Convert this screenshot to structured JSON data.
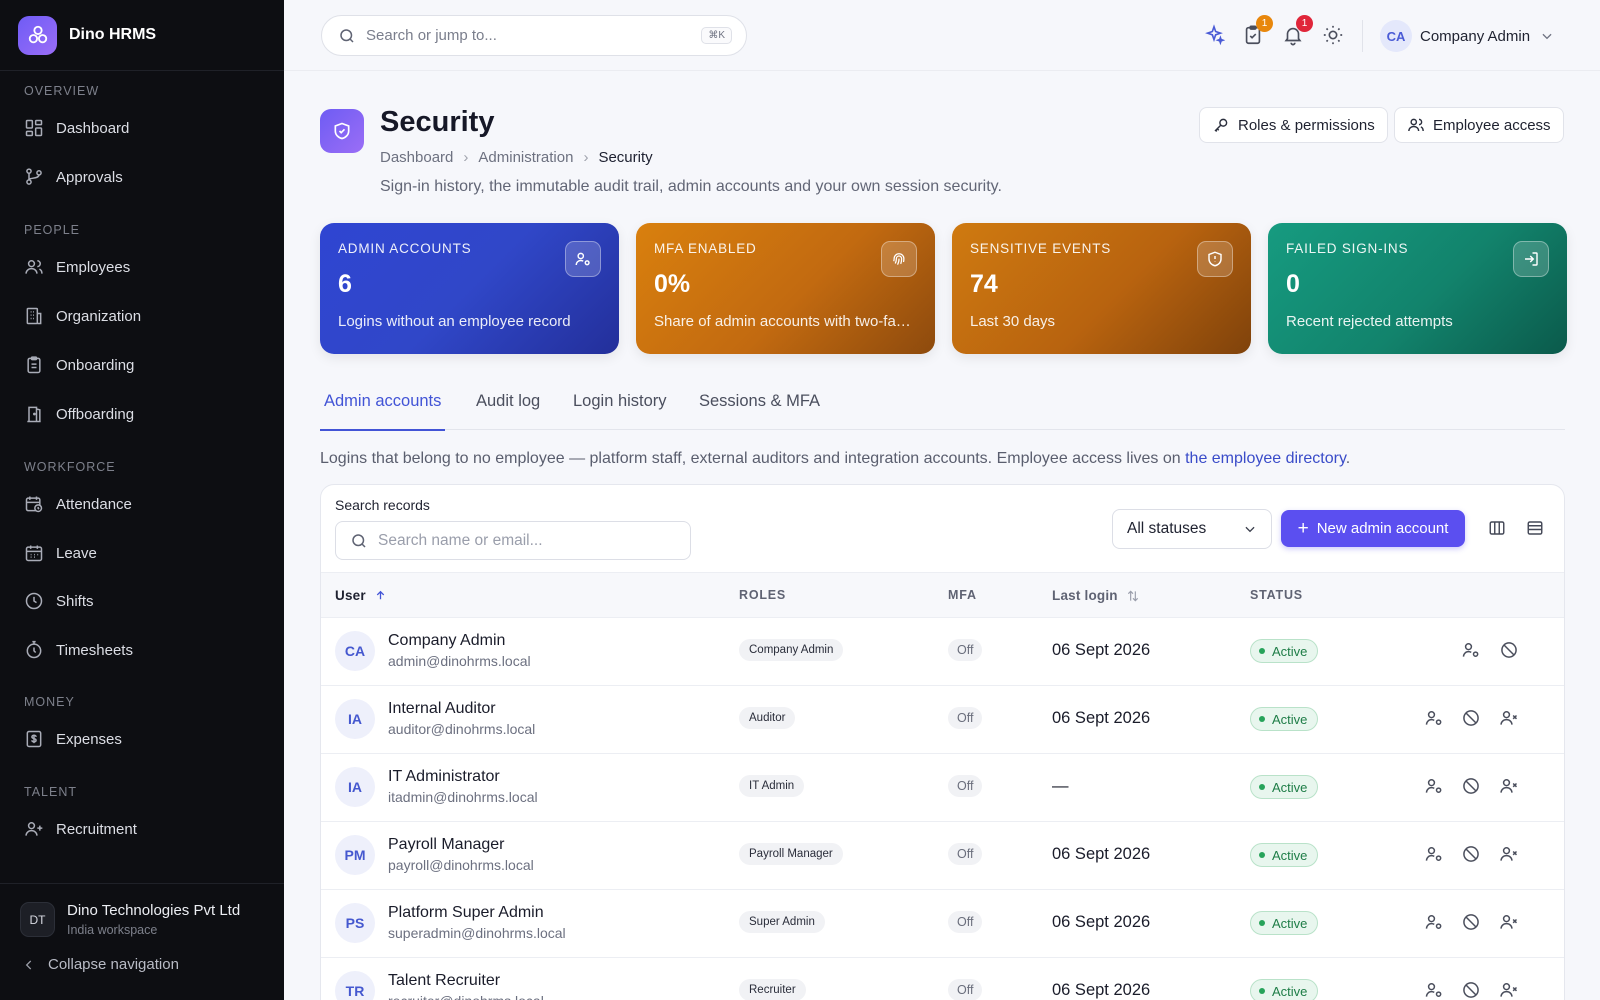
{
  "brand": {
    "name": "Dino HRMS"
  },
  "sidebar": {
    "sections": [
      {
        "title": "OVERVIEW",
        "items": [
          {
            "label": "Dashboard",
            "icon": "grid-icon"
          },
          {
            "label": "Approvals",
            "icon": "branch-icon"
          }
        ]
      },
      {
        "title": "PEOPLE",
        "items": [
          {
            "label": "Employees",
            "icon": "users-icon"
          },
          {
            "label": "Organization",
            "icon": "building-icon"
          },
          {
            "label": "Onboarding",
            "icon": "clipboard-icon"
          },
          {
            "label": "Offboarding",
            "icon": "door-icon"
          }
        ]
      },
      {
        "title": "WORKFORCE",
        "items": [
          {
            "label": "Attendance",
            "icon": "calendar-clock-icon"
          },
          {
            "label": "Leave",
            "icon": "calendar-icon"
          },
          {
            "label": "Shifts",
            "icon": "clock-icon"
          },
          {
            "label": "Timesheets",
            "icon": "timer-icon"
          }
        ]
      },
      {
        "title": "MONEY",
        "items": [
          {
            "label": "Expenses",
            "icon": "receipt-icon"
          }
        ]
      },
      {
        "title": "TALENT",
        "items": [
          {
            "label": "Recruitment",
            "icon": "user-plus-icon"
          }
        ]
      }
    ],
    "org": {
      "initials": "DT",
      "name": "Dino Technologies Pvt Ltd",
      "sub": "India workspace"
    },
    "collapse_label": "Collapse navigation"
  },
  "topbar": {
    "search_placeholder": "Search or jump to...",
    "search_shortcut": "⌘K",
    "tasks_badge": "1",
    "notifications_badge": "1",
    "user": {
      "initials": "CA",
      "name": "Company Admin"
    }
  },
  "page": {
    "title": "Security",
    "breadcrumb": [
      "Dashboard",
      "Administration",
      "Security"
    ],
    "description": "Sign-in history, the immutable audit trail, admin accounts and your own session security.",
    "actions": {
      "roles": "Roles & permissions",
      "employee_access": "Employee access"
    }
  },
  "stats": [
    {
      "label": "ADMIN ACCOUNTS",
      "value": "6",
      "sub": "Logins without an employee record",
      "icon": "user-cog-icon",
      "color": "#3a4dd8"
    },
    {
      "label": "MFA ENABLED",
      "value": "0%",
      "sub": "Share of admin accounts with two-factor authentication",
      "icon": "fingerprint-icon",
      "color": "#c26a10"
    },
    {
      "label": "SENSITIVE EVENTS",
      "value": "74",
      "sub": "Last 30 days",
      "icon": "shield-alert-icon",
      "color": "#b8630f"
    },
    {
      "label": "FAILED SIGN-INS",
      "value": "0",
      "sub": "Recent rejected attempts",
      "icon": "sign-in-icon",
      "color": "#12836c"
    }
  ],
  "tabs": [
    "Admin accounts",
    "Audit log",
    "Login history",
    "Sessions & MFA"
  ],
  "intro": {
    "text": "Logins that belong to no employee — platform staff, external auditors and integration accounts. Employee access lives on ",
    "link": "the employee directory",
    "end": "."
  },
  "table": {
    "search_label": "Search records",
    "search_placeholder": "Search name or email...",
    "status_filter": "All statuses",
    "new_button": "New admin account",
    "columns": {
      "user": "User",
      "roles": "ROLES",
      "mfa": "MFA",
      "last_login": "Last login",
      "status": "STATUS"
    },
    "rows": [
      {
        "initials": "CA",
        "name": "Company Admin",
        "email": "admin@dinohrms.local",
        "role": "Company Admin",
        "mfa": "Off",
        "last_login": "06 Sept 2026",
        "status": "Active"
      },
      {
        "initials": "IA",
        "name": "Internal Auditor",
        "email": "auditor@dinohrms.local",
        "role": "Auditor",
        "mfa": "Off",
        "last_login": "06 Sept 2026",
        "status": "Active"
      },
      {
        "initials": "IA",
        "name": "IT Administrator",
        "email": "itadmin@dinohrms.local",
        "role": "IT Admin",
        "mfa": "Off",
        "last_login": "—",
        "status": "Active"
      },
      {
        "initials": "PM",
        "name": "Payroll Manager",
        "email": "payroll@dinohrms.local",
        "role": "Payroll Manager",
        "mfa": "Off",
        "last_login": "06 Sept 2026",
        "status": "Active"
      },
      {
        "initials": "PS",
        "name": "Platform Super Admin",
        "email": "superadmin@dinohrms.local",
        "role": "Super Admin",
        "mfa": "Off",
        "last_login": "06 Sept 2026",
        "status": "Active"
      },
      {
        "initials": "TR",
        "name": "Talent Recruiter",
        "email": "recruiter@dinohrms.local",
        "role": "Recruiter",
        "mfa": "Off",
        "last_login": "06 Sept 2026",
        "status": "Active"
      }
    ]
  }
}
